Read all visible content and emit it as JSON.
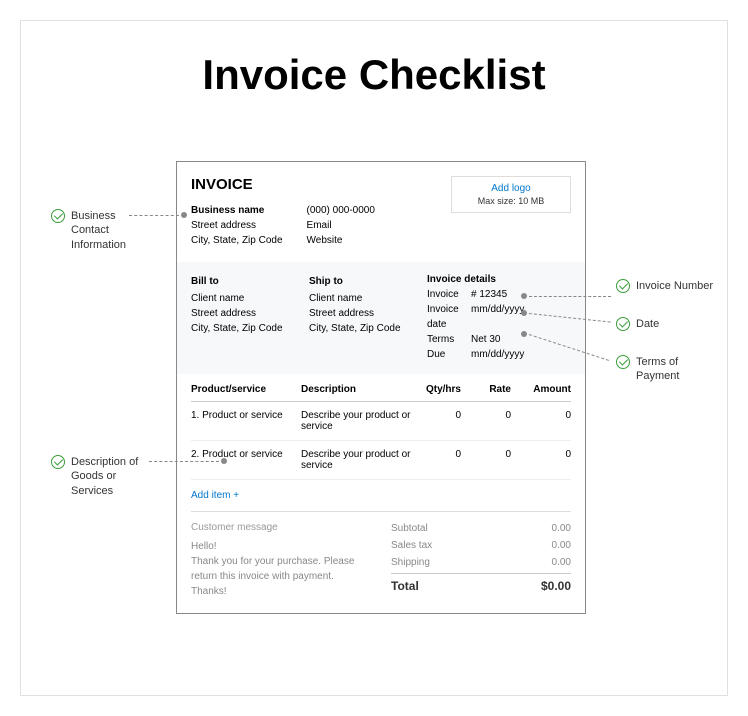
{
  "title": "Invoice Checklist",
  "invoice": {
    "heading": "INVOICE",
    "business": {
      "name": "Business name",
      "street": "Street address",
      "city": "City, State, Zip Code",
      "phone": "(000) 000-0000",
      "email": "Email",
      "website": "Website"
    },
    "logo": {
      "add": "Add logo",
      "maxsize": "Max size: 10 MB"
    },
    "bill_to": {
      "heading": "Bill to",
      "name": "Client name",
      "street": "Street address",
      "city": "City, State, Zip Code"
    },
    "ship_to": {
      "heading": "Ship to",
      "name": "Client name",
      "street": "Street address",
      "city": "City, State, Zip Code"
    },
    "details": {
      "heading": "Invoice details",
      "invoice_label": "Invoice",
      "invoice_num": "# 12345",
      "date_label": "Invoice date",
      "date_val": "mm/dd/yyyy",
      "terms_label": "Terms",
      "terms_val": "Net 30",
      "due_label": "Due",
      "due_val": "mm/dd/yyyy"
    },
    "columns": {
      "ps": "Product/service",
      "desc": "Description",
      "qty": "Qty/hrs",
      "rate": "Rate",
      "amount": "Amount"
    },
    "items": [
      {
        "num": "1.",
        "name": "Product or service",
        "desc": "Describe your product or service",
        "qty": "0",
        "rate": "0",
        "amount": "0"
      },
      {
        "num": "2.",
        "name": "Product or service",
        "desc": "Describe your product or service",
        "qty": "0",
        "rate": "0",
        "amount": "0"
      }
    ],
    "add_item": "Add item +",
    "customer_message": {
      "title": "Customer message",
      "body": "Hello!\nThank you for your purchase. Please return this invoice with payment.\nThanks!"
    },
    "totals": {
      "subtotal_label": "Subtotal",
      "subtotal": "0.00",
      "tax_label": "Sales tax",
      "tax": "0.00",
      "shipping_label": "Shipping",
      "shipping": "0.00",
      "total_label": "Total",
      "total": "$0.00"
    }
  },
  "annotations": {
    "business_contact": "Business\nContact\nInformation",
    "description": "Description of\nGoods or\nServices",
    "invoice_number": "Invoice Number",
    "date": "Date",
    "terms": "Terms of\nPayment"
  }
}
